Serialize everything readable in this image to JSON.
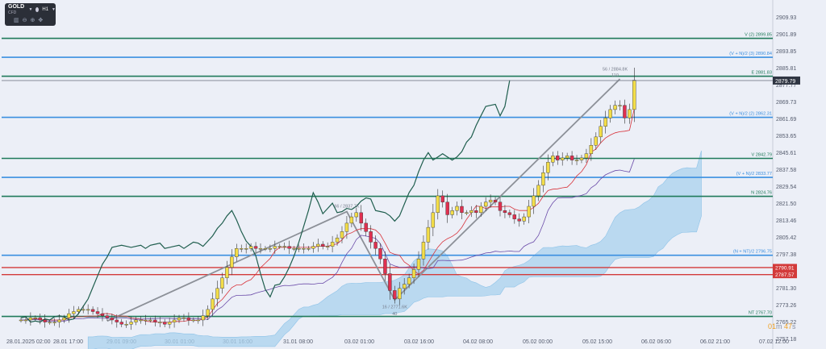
{
  "toolbar": {
    "symbol": "GOLD",
    "symbol_suffix": "CFD",
    "timeframe": "H1",
    "tool_icons": [
      "chart-type-icon",
      "zoom-out-icon",
      "zoom-in-icon",
      "crosshair-icon"
    ]
  },
  "timer": {
    "minutes": "01",
    "m_label": "m",
    "seconds": "47",
    "s_label": "s"
  },
  "colors": {
    "background": "#eceff7",
    "green_level": "#1f7a5a",
    "blue_level": "#3a8fe0",
    "red_level": "#d33a3a",
    "price_badge": "#2f3542",
    "bull_candle": "#f3dd48",
    "bear_candle": "#e03050",
    "cloud": "#a9d2ee",
    "chikou": "#1f5e4e",
    "tenkan": "#d8323a",
    "kijun": "#6a4aa8",
    "wave": "#8c9098"
  },
  "chart_data": {
    "type": "candlestick",
    "symbol": "GOLD",
    "timeframe": "H1",
    "ylim": [
      2757.18,
      2915.0
    ],
    "y_ticks": [
      2909.93,
      2901.89,
      2893.85,
      2885.81,
      2877.77,
      2869.73,
      2861.69,
      2853.65,
      2845.61,
      2837.58,
      2829.54,
      2821.5,
      2813.46,
      2805.42,
      2797.38,
      2789.34,
      2781.3,
      2773.26,
      2765.22,
      2757.18
    ],
    "x_labels": [
      "28.01.2025 02:00",
      "28.01 17:00",
      "29.01 09:00",
      "30.01 01:00",
      "30.01 16:00",
      "31.01 08:00",
      "03.02 01:00",
      "03.02 16:00",
      "04.02 08:00",
      "05.02 00:00",
      "05.02 15:00",
      "06.02 06:00",
      "06.02 21:00",
      "07.02 12:00"
    ],
    "current_price": "2879.79",
    "levels": [
      {
        "label": "V (2) 2899.85",
        "price": 2899.85,
        "color": "green"
      },
      {
        "label": "(V + N)/2 (3) 2890.84",
        "price": 2890.84,
        "color": "blue"
      },
      {
        "label": "E 2881.83",
        "price": 2881.83,
        "color": "green"
      },
      {
        "label": "(V + N)/2 (2) 2862.31",
        "price": 2862.31,
        "color": "blue"
      },
      {
        "label": "V 2842.79",
        "price": 2842.79,
        "color": "green"
      },
      {
        "label": "(V + N)/2 2833.77",
        "price": 2833.77,
        "color": "blue"
      },
      {
        "label": "N 2824.76",
        "price": 2824.76,
        "color": "green"
      },
      {
        "label": "(N + NT)/2 2796.75",
        "price": 2796.75,
        "color": "blue"
      },
      {
        "label": "NT 2767.70",
        "price": 2767.7,
        "color": "green"
      }
    ],
    "red_levels": [
      {
        "label": "2790.91",
        "price": 2790.91
      },
      {
        "label": "2787.57",
        "price": 2787.57
      }
    ],
    "wave_labels": [
      {
        "text": "66 / 2837.7K",
        "price": 2819.5,
        "bar": 68
      },
      {
        "text": "56 / 2884.8K",
        "price": 2884.6,
        "bar": 124
      },
      {
        "text": "110",
        "price": 2881.7,
        "bar": 124
      },
      {
        "text": "16 / 2771.6K",
        "price": 2771.6,
        "bar": 78
      },
      {
        "text": "40",
        "price": 2768.3,
        "bar": 78
      }
    ],
    "wave_points": [
      {
        "bar": 18,
        "price": 2765.5
      },
      {
        "bar": 68,
        "price": 2817.5
      },
      {
        "bar": 78,
        "price": 2775.5
      },
      {
        "bar": 125,
        "price": 2880.5
      }
    ],
    "closes": [
      2766,
      2766,
      2767,
      2767,
      2766,
      2765,
      2765,
      2765,
      2766,
      2767,
      2769,
      2770,
      2771,
      2771,
      2771,
      2770,
      2769,
      2768,
      2767,
      2766,
      2765,
      2764,
      2764,
      2765,
      2766,
      2766,
      2766,
      2766,
      2765,
      2765,
      2764,
      2765,
      2766,
      2767,
      2767,
      2766,
      2766,
      2766,
      2768,
      2771,
      2776,
      2781,
      2786,
      2791,
      2796,
      2800,
      2800,
      2800,
      2801,
      2800,
      2800,
      2800,
      2800,
      2801,
      2801,
      2801,
      2800,
      2800,
      2800,
      2800,
      2800,
      2801,
      2802,
      2801,
      2801,
      2803,
      2805,
      2808,
      2812,
      2815,
      2817,
      2812,
      2808,
      2803,
      2800,
      2795,
      2788,
      2780,
      2776,
      2781,
      2783,
      2786,
      2790,
      2795,
      2803,
      2810,
      2817,
      2825,
      2822,
      2816,
      2818,
      2820,
      2817,
      2817,
      2818,
      2817,
      2820,
      2822,
      2823,
      2822,
      2818,
      2817,
      2816,
      2814,
      2813,
      2815,
      2820,
      2825,
      2830,
      2836,
      2841,
      2844,
      2842,
      2843,
      2844,
      2842,
      2842,
      2843,
      2845,
      2849,
      2853,
      2858,
      2862,
      2866,
      2868,
      2868,
      2862,
      2866,
      2880
    ]
  }
}
